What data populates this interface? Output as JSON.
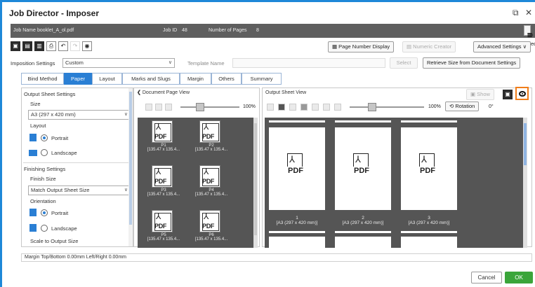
{
  "window": {
    "title": "Job Director - Imposer",
    "restore_icon": "restore-icon",
    "close_icon": "close-icon"
  },
  "infobar": {
    "job_name_label": "Job Name",
    "job_name_value": "booklet_A_ol.pdf",
    "job_id_label": "Job ID",
    "job_id_value": "48",
    "pages_label": "Number of Pages",
    "pages_value": "8",
    "to_sequencer": "To Sequencer"
  },
  "toolbar": {
    "page_number_display": "Page Number Display",
    "numeric_creator": "Numeric Creator",
    "advanced_settings": "Advanced Settings"
  },
  "imposition": {
    "label": "Imposition Settings",
    "value": "Custom",
    "template_label": "Template Name",
    "select_btn": "Select",
    "retrieve_btn": "Retrieve Size from Document Settings"
  },
  "tabs": [
    "Bind Method",
    "Paper",
    "Layout",
    "Marks and Slugs",
    "Margin",
    "Others",
    "Summary"
  ],
  "left_panel": {
    "output_sheet_settings": "Output Sheet Settings",
    "size_label": "Size",
    "size_value": "A3 (297 x 420 mm)",
    "layout_label": "Layout",
    "portrait": "Portrait",
    "landscape": "Landscape",
    "finishing_settings": "Finishing Settings",
    "finish_size_label": "Finish Size",
    "finish_size_value": "Match Output Sheet Size",
    "orientation_label": "Orientation",
    "portrait2": "Portrait",
    "landscape2": "Landscape",
    "scale_label": "Scale to Output Size"
  },
  "doc_view": {
    "title": "Document Page View",
    "zoom": "100%",
    "pdf_text": "PDF",
    "pages": [
      {
        "name": "P1",
        "size": "[135.47 x 135.4..."
      },
      {
        "name": "P2",
        "size": "[135.47 x 135.4..."
      },
      {
        "name": "P3",
        "size": "[135.47 x 135.4..."
      },
      {
        "name": "P4",
        "size": "[135.47 x 135.4..."
      },
      {
        "name": "P5",
        "size": "[135.47 x 135.4..."
      },
      {
        "name": "P6",
        "size": "[135.47 x 135.4..."
      }
    ]
  },
  "output_view": {
    "title": "Output Sheet View",
    "show_btn": "Show",
    "zoom": "100%",
    "rotation_btn": "Rotation",
    "rotation_value": "0°",
    "pdf_text": "PDF",
    "sheets": [
      {
        "num": "1",
        "size": "[A3 (297 x 420 mm)]"
      },
      {
        "num": "2",
        "size": "[A3 (297 x 420 mm)]"
      },
      {
        "num": "3",
        "size": "[A3 (297 x 420 mm)]"
      }
    ]
  },
  "status": {
    "text": "Margin  Top/Bottom  0.00mm  Left/Right  0.00mm"
  },
  "footer": {
    "cancel": "Cancel",
    "ok": "OK"
  },
  "colors": {
    "accent": "#2a7fd4",
    "ok_green": "#3aa53a",
    "highlight_orange": "#f07d1a",
    "info_bar": "#5f5f5f"
  }
}
